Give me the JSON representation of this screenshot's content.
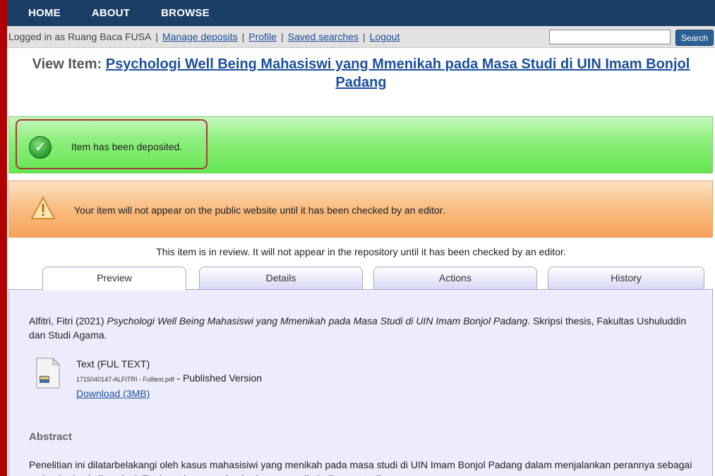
{
  "nav": {
    "items": [
      "HOME",
      "ABOUT",
      "BROWSE"
    ]
  },
  "userbar": {
    "logged_in_text": "Logged in as Ruang Baca FUSA",
    "links": [
      "Manage deposits",
      "Profile",
      "Saved searches",
      "Logout"
    ],
    "search_placeholder": "",
    "search_button": "Search"
  },
  "title": {
    "prefix": "View Item:",
    "item_title": "Psychologi Well Being Mahasiswi yang Mmenikah pada Masa Studi di UIN Imam Bonjol Padang"
  },
  "messages": {
    "success": "Item has been deposited.",
    "warning": "Your item will not appear on the public website until it has been checked by an editor."
  },
  "review_note": "This item is in review. It will not appear in the repository until it has been checked by an editor.",
  "tabs": [
    {
      "label": "Preview",
      "active": true
    },
    {
      "label": "Details",
      "active": false
    },
    {
      "label": "Actions",
      "active": false
    },
    {
      "label": "History",
      "active": false
    }
  ],
  "citation": {
    "authors": "Alfitri, Fitri (2021)",
    "title": "Psychologi Well Being Mahasiswi yang Mmenikah pada Masa Studi di UIN Imam Bonjol Padang",
    "rest": ". Skripsi thesis, Fakultas Ushuluddin dan Studi Agama."
  },
  "document": {
    "type_label": "Text (FUL TEXT)",
    "filename": "1715040147-ALFITRI - Fulltext.pdf",
    "version": " - Published Version",
    "download": "Download (3MB)"
  },
  "abstract": {
    "heading": "Abstract",
    "text": "Penelitian ini dilatarbelakangi oleh kasus mahasisiwi yang menikah pada masa studi di UIN Imam Bonjol Padang dalam menjalankan perannya sebagai mahasiswi sekaligus istri. Terdapat kasus mahasiswi yang menikah dimasa studi namun"
  },
  "colors": {
    "nav_bg": "#1b3e66",
    "link": "#1c4f9c",
    "success_bg": "#66e552",
    "warning_bg": "#f6a25a",
    "outer_border": "#b00000"
  }
}
